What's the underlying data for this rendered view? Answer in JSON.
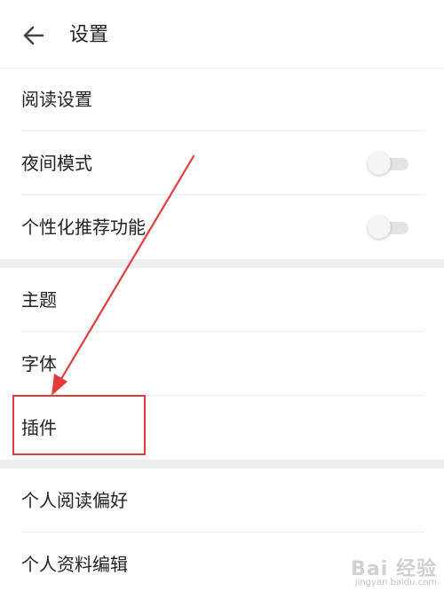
{
  "header": {
    "back_icon": "arrow-left-icon",
    "title": "设置"
  },
  "section1": {
    "items": [
      {
        "label": "阅读设置"
      },
      {
        "label": "夜间模式",
        "toggle": false
      },
      {
        "label": "个性化推荐功能",
        "toggle": false
      }
    ]
  },
  "section2": {
    "items": [
      {
        "label": "主题"
      },
      {
        "label": "字体"
      },
      {
        "label": "插件"
      }
    ]
  },
  "section3": {
    "items": [
      {
        "label": "个人阅读偏好"
      },
      {
        "label": "个人资料编辑"
      }
    ]
  },
  "annotation": {
    "highlight_color": "#e33b3b"
  },
  "watermark": {
    "main": "Bai 经验",
    "sub": "jingyan.baidu.com"
  }
}
